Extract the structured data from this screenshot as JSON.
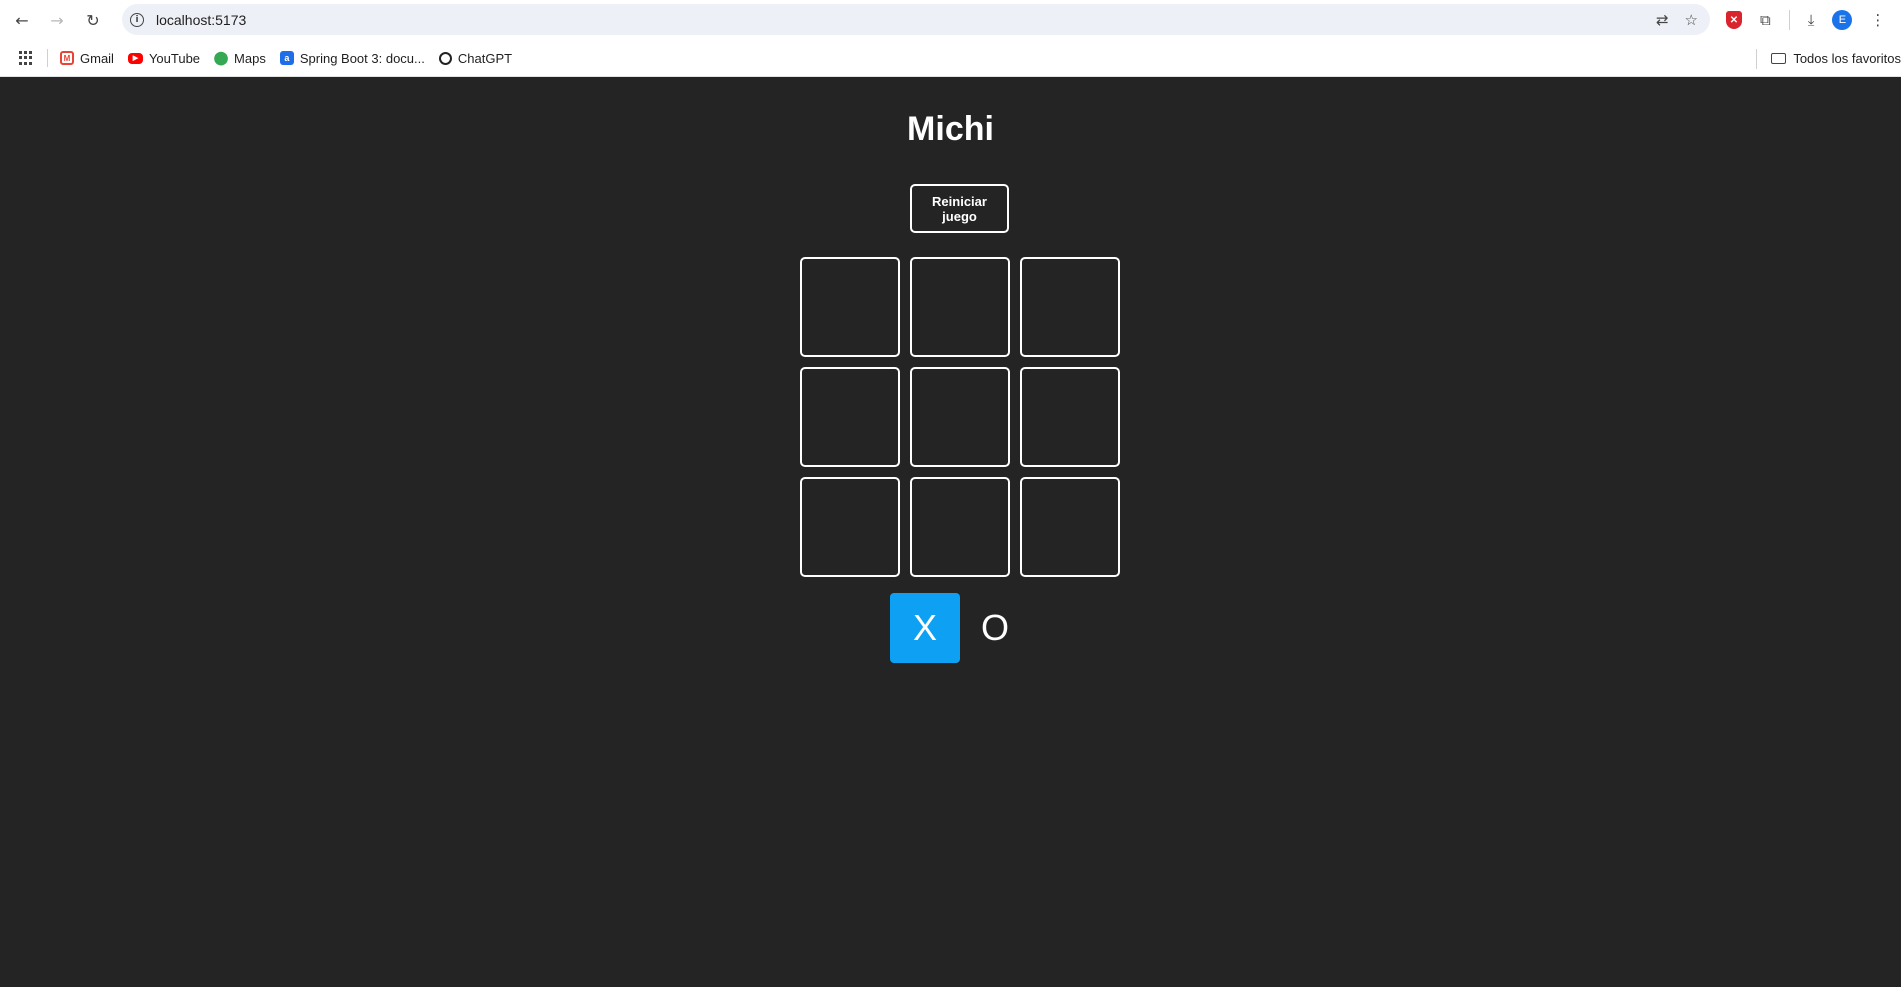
{
  "browser": {
    "url": "localhost:5173",
    "bookmarks": [
      {
        "label": "Gmail",
        "icon": "gmail-icon"
      },
      {
        "label": "YouTube",
        "icon": "youtube-icon"
      },
      {
        "label": "Maps",
        "icon": "maps-icon"
      },
      {
        "label": "Spring Boot 3: docu...",
        "icon": "spring-icon"
      },
      {
        "label": "ChatGPT",
        "icon": "chatgpt-icon"
      }
    ],
    "all_bookmarks_label": "Todos los favoritos",
    "profile_initial": "E"
  },
  "game": {
    "title": "Michi",
    "reset_label": "Reiniciar juego",
    "board": [
      "",
      "",
      "",
      "",
      "",
      "",
      "",
      "",
      ""
    ],
    "turns": [
      "X",
      "O"
    ],
    "active_turn": "X"
  },
  "colors": {
    "background": "#242424",
    "accent": "#0ea0f3",
    "border": "#ffffff"
  }
}
